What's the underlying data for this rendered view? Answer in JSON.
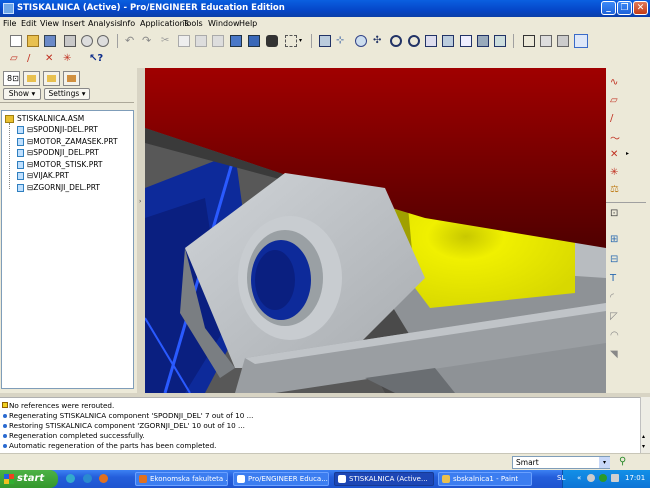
{
  "window": {
    "title": "STISKALNICA (Active) - Pro/ENGINEER Education Edition",
    "minimize_icon": "minimize-icon",
    "restore_icon": "restore-icon",
    "close_icon": "close-icon"
  },
  "menu": [
    "File",
    "Edit",
    "View",
    "Insert",
    "Analysis",
    "Info",
    "Applications",
    "Tools",
    "Window",
    "Help"
  ],
  "navigator": {
    "show_label": "Show",
    "settings_label": "Settings",
    "tree": [
      {
        "label": "STISKALNICA.ASM",
        "type": "assembly"
      },
      {
        "label": "SPODNJI-DEL.PRT",
        "type": "part"
      },
      {
        "label": "MOTOR_ZAMASEK.PRT",
        "type": "part"
      },
      {
        "label": "SPODNJI_DEL.PRT",
        "type": "part"
      },
      {
        "label": "MOTOR_STISK.PRT",
        "type": "part"
      },
      {
        "label": "VIJAK.PRT",
        "type": "part"
      },
      {
        "label": "ZGORNJI_DEL.PRT",
        "type": "part"
      }
    ]
  },
  "messages": [
    "No references were rerouted.",
    "Regenerating STISKALNICA component 'SPODNJI_DEL' 7 out of 10 ...",
    "Restoring STISKALNICA component 'ZGORNJI_DEL' 10 out of 10 ...",
    "Regeneration completed successfully.",
    "Automatic regeneration of the parts has been completed."
  ],
  "filter": {
    "value": "Smart"
  },
  "taskbar": {
    "start_label": "start",
    "tasks": [
      {
        "label": "Ekonomska fakulteta ...",
        "active": false
      },
      {
        "label": "Pro/ENGINEER Educa...",
        "active": false
      },
      {
        "label": "STISKALNICA (Active...",
        "active": true
      },
      {
        "label": "sbskalnica1 - Paint",
        "active": false
      }
    ],
    "language": "SL",
    "clock": "17:01"
  },
  "colors": {
    "titlebar": "#0a4fd8",
    "viewport_red": "#8b0000",
    "part_gray": "#b4b8bc",
    "part_yellow": "#e8e800",
    "part_blue": "#0d2a9a"
  }
}
